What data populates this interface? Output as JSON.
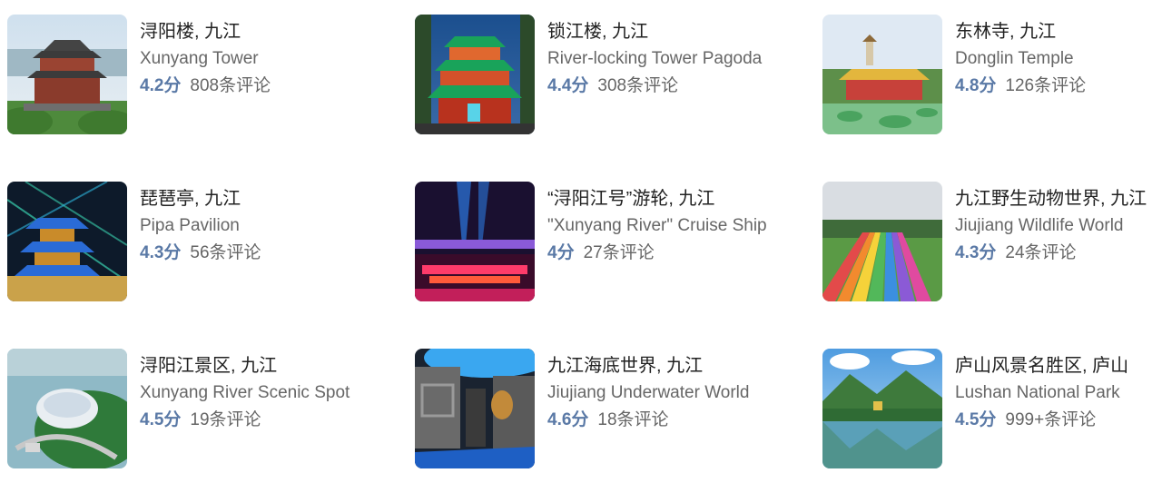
{
  "colors": {
    "title": "#222222",
    "subtitle": "#666666",
    "score": "#5a79a6",
    "reviews": "#666666"
  },
  "attractions": [
    {
      "name_cn": "浔阳楼, 九江",
      "name_en": "Xunyang Tower",
      "score": "4.2分",
      "reviews": "808条评论",
      "thumb": "xunyang-tower-photo"
    },
    {
      "name_cn": "锁江楼, 九江",
      "name_en": "River-locking Tower Pagoda",
      "score": "4.4分",
      "reviews": "308条评论",
      "thumb": "suojiang-tower-photo"
    },
    {
      "name_cn": "东林寺, 九江",
      "name_en": "Donglin Temple",
      "score": "4.8分",
      "reviews": "126条评论",
      "thumb": "donglin-temple-photo"
    },
    {
      "name_cn": "琵琶亭, 九江",
      "name_en": "Pipa Pavilion",
      "score": "4.3分",
      "reviews": "56条评论",
      "thumb": "pipa-pavilion-photo"
    },
    {
      "name_cn": "“浔阳江号”游轮, 九江",
      "name_en": "\"Xunyang River\" Cruise Ship",
      "score": "4分",
      "reviews": "27条评论",
      "thumb": "cruise-ship-photo"
    },
    {
      "name_cn": "九江野生动物世界, 九江",
      "name_en": "Jiujiang Wildlife World",
      "score": "4.3分",
      "reviews": "24条评论",
      "thumb": "wildlife-world-photo"
    },
    {
      "name_cn": "浔阳江景区, 九江",
      "name_en": "Xunyang River Scenic Spot",
      "score": "4.5分",
      "reviews": "19条评论",
      "thumb": "scenic-spot-photo"
    },
    {
      "name_cn": "九江海底世界, 九江",
      "name_en": "Jiujiang Underwater World",
      "score": "4.6分",
      "reviews": "18条评论",
      "thumb": "underwater-world-photo"
    },
    {
      "name_cn": "庐山风景名胜区, 庐山",
      "name_en": "Lushan National Park",
      "score": "4.5分",
      "reviews": "999+条评论",
      "thumb": "lushan-park-photo"
    }
  ]
}
